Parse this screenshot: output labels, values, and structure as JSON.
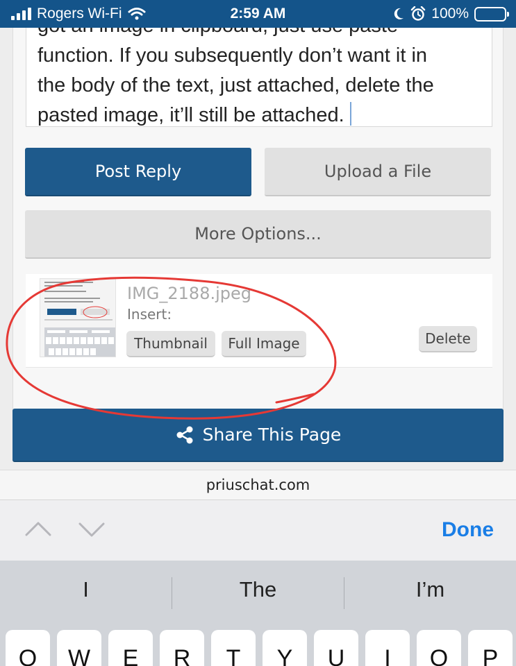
{
  "status_bar": {
    "carrier": "Rogers Wi-Fi",
    "time": "2:59 AM",
    "battery": "100%",
    "icons": [
      "signal-icon",
      "wifi-icon",
      "moon-icon",
      "alarm-icon",
      "battery-icon"
    ]
  },
  "editor": {
    "lines": [
      "got an image in clipboard, just use paste",
      "function. If you subsequently don’t want it in",
      "the body of the text, just attached, delete the",
      "pasted image, it’ll still be attached."
    ]
  },
  "buttons": {
    "post_reply": "Post Reply",
    "upload_file": "Upload a File",
    "more_options": "More Options...",
    "share_page": "Share This Page"
  },
  "attachment": {
    "filename": "IMG_2188.jpeg",
    "insert_label": "Insert:",
    "thumbnail_button": "Thumbnail",
    "full_image_button": "Full Image",
    "delete_button": "Delete"
  },
  "url_bar": {
    "domain": "priuschat.com"
  },
  "accessory_bar": {
    "done": "Done"
  },
  "keyboard": {
    "suggestions": [
      "I",
      "The",
      "I’m"
    ],
    "keys": [
      "Q",
      "W",
      "E",
      "R",
      "T",
      "Y",
      "U",
      "I",
      "O",
      "P"
    ]
  },
  "colors": {
    "brand": "#1e5a8c",
    "status_bar": "#14548a",
    "annotation": "#e53935",
    "ios_blue": "#1a7ee6"
  }
}
